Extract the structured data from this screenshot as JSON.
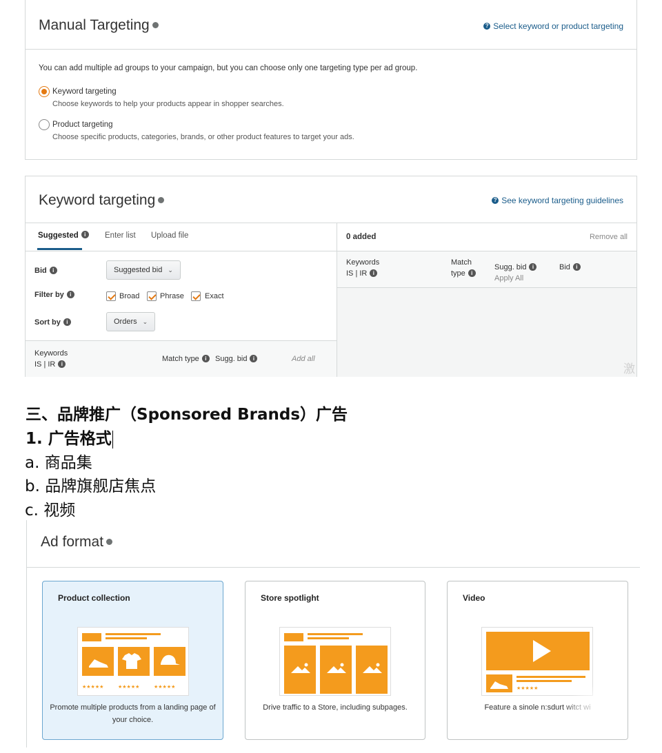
{
  "manual_targeting": {
    "title": "Manual Targeting",
    "help_link": "Select keyword or product targeting",
    "intro": "You can add multiple ad groups to your campaign, but you can choose only one targeting type per ad group.",
    "options": [
      {
        "label": "Keyword targeting",
        "desc": "Choose keywords to help your products appear in shopper searches.",
        "selected": true
      },
      {
        "label": "Product targeting",
        "desc": "Choose specific products, categories, brands, or other product features to target your ads.",
        "selected": false
      }
    ]
  },
  "keyword_targeting": {
    "title": "Keyword targeting",
    "help_link": "See keyword targeting guidelines",
    "tabs": [
      "Suggested",
      "Enter list",
      "Upload file"
    ],
    "bid_label": "Bid",
    "bid_value": "Suggested bid",
    "filter_label": "Filter by",
    "filters": [
      "Broad",
      "Phrase",
      "Exact"
    ],
    "sort_label": "Sort by",
    "sort_value": "Orders",
    "left_cols": {
      "keywords": "Keywords",
      "is_ir": "IS | IR",
      "match_type": "Match type",
      "sugg_bid": "Sugg. bid",
      "add_all": "Add all"
    },
    "right": {
      "added": "0 added",
      "remove_all": "Remove all",
      "keywords": "Keywords",
      "is_ir": "IS | IR",
      "match": "Match",
      "type": "type",
      "sugg_bid": "Sugg. bid",
      "apply_all": "Apply All",
      "bid": "Bid"
    },
    "watermark": "激"
  },
  "article": {
    "heading": "三、品牌推广（Sponsored Brands）广告",
    "subheading": "1. 广告格式",
    "items": [
      "a. 商品集",
      "b. 品牌旗舰店焦点",
      "c. 视频"
    ]
  },
  "ad_format": {
    "title": "Ad format",
    "cards": [
      {
        "title": "Product collection",
        "desc": "Promote multiple products from a landing page of your choice.",
        "selected": true,
        "stars": "★★★★★"
      },
      {
        "title": "Store spotlight",
        "desc": "Drive traffic to a Store, including subpages.",
        "selected": false
      },
      {
        "title": "Video",
        "desc": "Feature a sinole n:sdurt witct wi",
        "selected": false,
        "stars": "★★★★★"
      }
    ]
  },
  "colors": {
    "accent_orange": "#f49b1d",
    "link_blue": "#1a5c8a",
    "selected_card_bg": "#e6f2fb"
  }
}
